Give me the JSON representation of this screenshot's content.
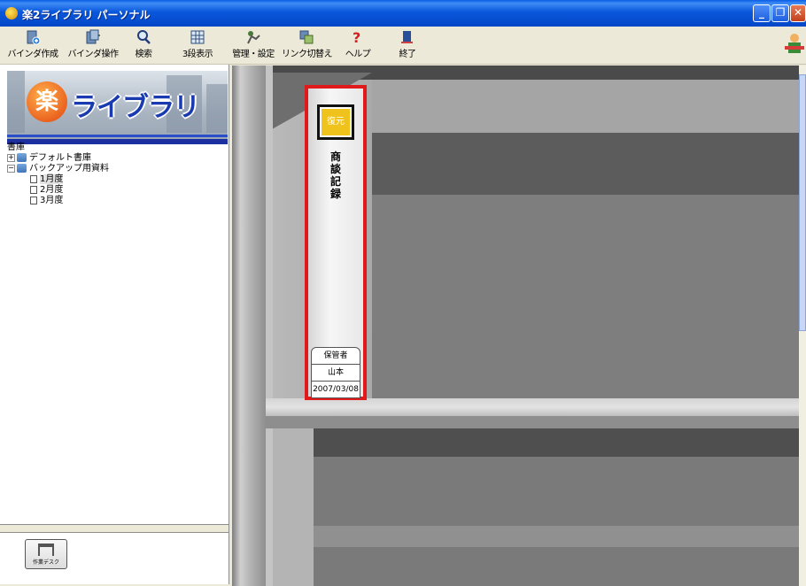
{
  "window": {
    "title": "楽2ライブラリ パーソナル",
    "controls": {
      "minimize": "_",
      "restore": "❐",
      "close": "✕"
    }
  },
  "toolbar": {
    "items": [
      {
        "label": "バインダ作成",
        "icon": "binder-new-icon"
      },
      {
        "label": "バインダ操作",
        "icon": "binder-operate-icon"
      },
      {
        "label": "検索",
        "icon": "search-icon"
      },
      {
        "label": "3段表示",
        "icon": "grid-icon"
      },
      {
        "label": "管理・設定",
        "icon": "settings-icon"
      },
      {
        "label": "リンク切替え",
        "icon": "link-switch-icon"
      },
      {
        "label": "ヘルプ",
        "icon": "help-icon"
      },
      {
        "label": "終了",
        "icon": "exit-icon"
      }
    ]
  },
  "sidebar": {
    "logo": {
      "kanji": "楽",
      "text": "ライブラリ"
    },
    "tree_root": "書庫",
    "tree": [
      {
        "label": "デフォルト書庫",
        "toggle": "+",
        "level": 1
      },
      {
        "label": "バックアップ用資料",
        "toggle": "−",
        "level": 1
      },
      {
        "label": "1月度",
        "level": 2,
        "selected": true
      },
      {
        "label": "2月度",
        "level": 2
      },
      {
        "label": "3月度",
        "level": 2
      }
    ],
    "desk_button": "作業デスク"
  },
  "binder": {
    "badge": "復元",
    "title": "商談記録",
    "card": {
      "label": "保管者",
      "owner": "山本",
      "date": "2007/03/08"
    },
    "badge_color": "#efc31b",
    "highlight_color": "#e01a1a"
  }
}
